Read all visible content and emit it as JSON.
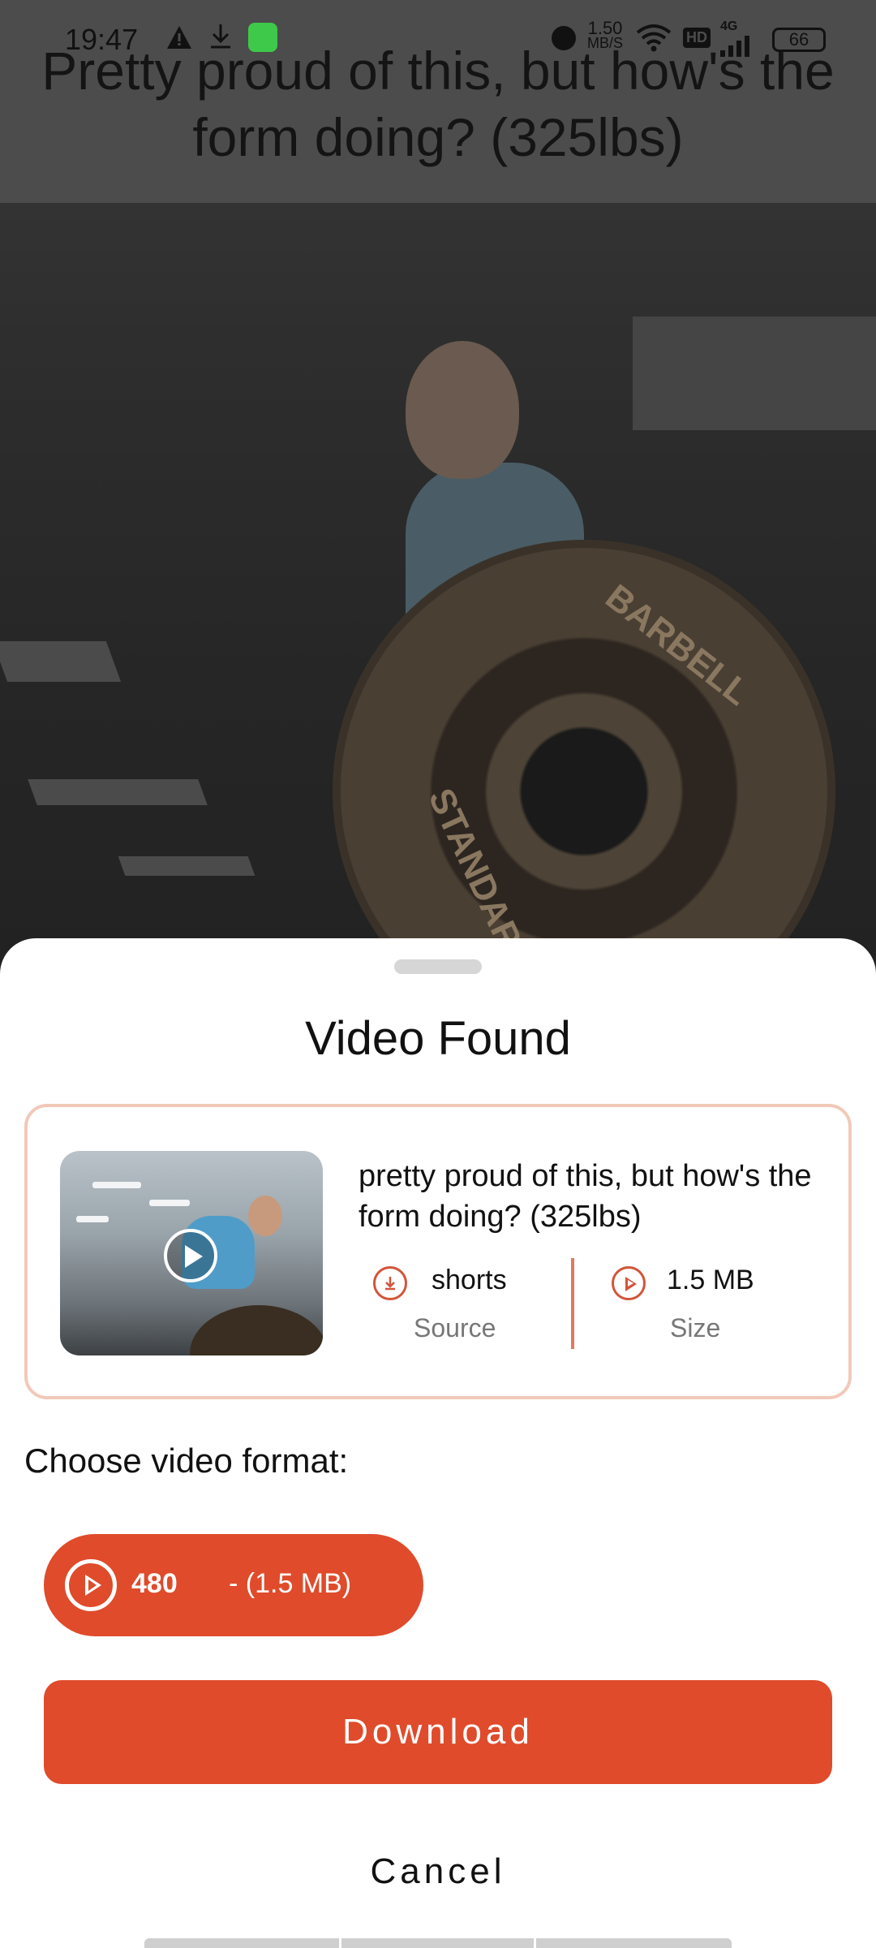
{
  "status_bar": {
    "time": "19:47",
    "net_speed_value": "1.50",
    "net_speed_unit": "MB/S",
    "hd": "HD",
    "network_type": "4G",
    "battery": "66"
  },
  "video_overlay": {
    "title": "Pretty proud of this, but how's the form doing? (325lbs)",
    "plate_text_1": "BARBELL",
    "plate_text_2": "STANDARD"
  },
  "sheet": {
    "title": "Video Found",
    "card": {
      "title": "pretty proud of this, but how's the form doing? (325lbs)",
      "source_value": "shorts",
      "source_label": "Source",
      "size_value": "1.5 MB",
      "size_label": "Size"
    },
    "format_heading": "Choose video format:",
    "format_option": {
      "quality": "480",
      "size": "- (1.5 MB)"
    },
    "download_label": "Download",
    "cancel_label": "Cancel"
  },
  "colors": {
    "accent": "#df4b2b",
    "card_border": "#f1c9b8",
    "overlay": "#4c4c4c"
  }
}
